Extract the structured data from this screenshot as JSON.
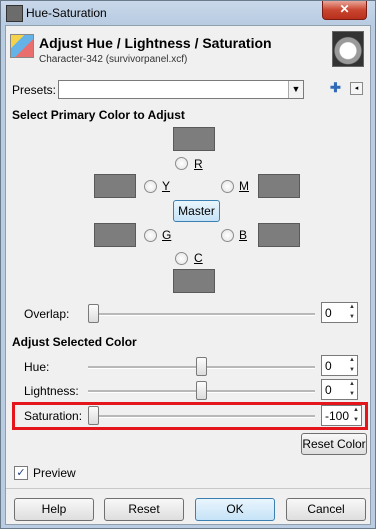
{
  "window": {
    "title": "Hue-Saturation",
    "close_glyph": "✕"
  },
  "header": {
    "title": "Adjust Hue / Lightness / Saturation",
    "subtitle": "Character-342 (survivorpanel.xcf)"
  },
  "presets": {
    "label": "Presets:",
    "value": "",
    "add_glyph": "✚",
    "menu_glyph": "◂"
  },
  "primary_color": {
    "heading": "Select Primary Color to Adjust",
    "channels": {
      "r": "R",
      "y": "Y",
      "m": "M",
      "g": "G",
      "b": "B",
      "c": "C"
    },
    "master_label": "Master",
    "swatch_color": "#7d7d7d"
  },
  "overlap": {
    "label": "Overlap:",
    "value": "0"
  },
  "adjust": {
    "heading": "Adjust Selected Color",
    "hue": {
      "label": "Hue:",
      "value": "0"
    },
    "lightness": {
      "label": "Lightness:",
      "value": "0"
    },
    "saturation": {
      "label": "Saturation:",
      "value": "-100"
    },
    "reset_color": "Reset Color"
  },
  "preview": {
    "label": "Preview",
    "checked": true
  },
  "buttons": {
    "help": "Help",
    "reset": "Reset",
    "ok": "OK",
    "cancel": "Cancel"
  },
  "colors": {
    "highlight": "#e4161b",
    "titlebar": "#b9cce2"
  }
}
